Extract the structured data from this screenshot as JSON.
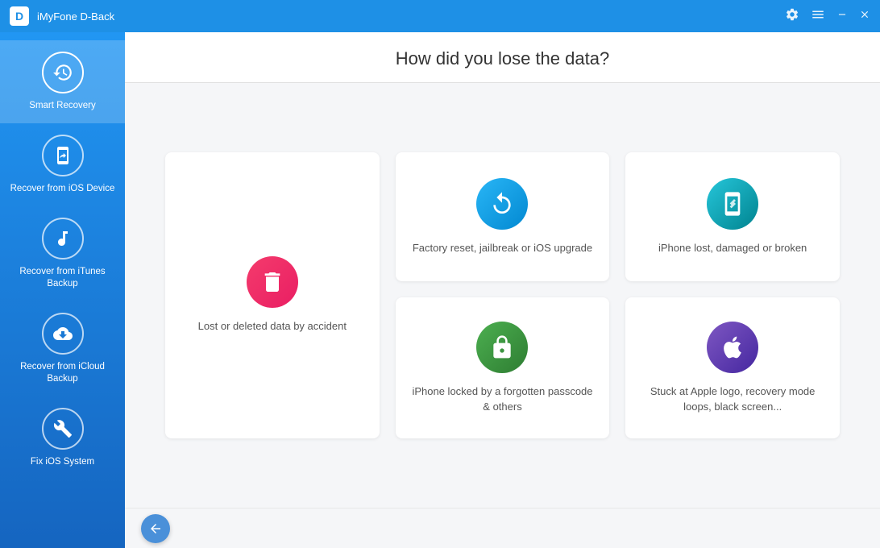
{
  "titlebar": {
    "app_name": "iMyFone D-Back",
    "logo_letter": "D"
  },
  "sidebar": {
    "items": [
      {
        "id": "smart-recovery",
        "label": "Smart Recovery",
        "active": true
      },
      {
        "id": "recover-ios",
        "label": "Recover from\niOS Device",
        "active": false
      },
      {
        "id": "recover-itunes",
        "label": "Recover from\niTunes Backup",
        "active": false
      },
      {
        "id": "recover-icloud",
        "label": "Recover from\niCloud Backup",
        "active": false
      },
      {
        "id": "fix-ios",
        "label": "Fix iOS System",
        "active": false
      }
    ]
  },
  "main": {
    "title": "How did you lose the data?",
    "cards": [
      {
        "id": "deleted",
        "label": "Lost or deleted data by accident",
        "icon_color": "#e91e63",
        "has_icon": true
      },
      {
        "id": "factory",
        "label": "Factory reset, jailbreak or iOS upgrade",
        "icon_color": "#29b6f6",
        "has_icon": true
      },
      {
        "id": "damaged",
        "label": "iPhone lost, damaged or broken",
        "icon_color": "#26c6da",
        "has_icon": true
      },
      {
        "id": "locked",
        "label": "iPhone locked by a forgotten passcode & others",
        "icon_color": "#4caf50",
        "has_icon": true
      },
      {
        "id": "stuck",
        "label": "Stuck at Apple logo, recovery mode loops, black screen...",
        "icon_color": "#7e57c2",
        "has_icon": true
      }
    ]
  }
}
